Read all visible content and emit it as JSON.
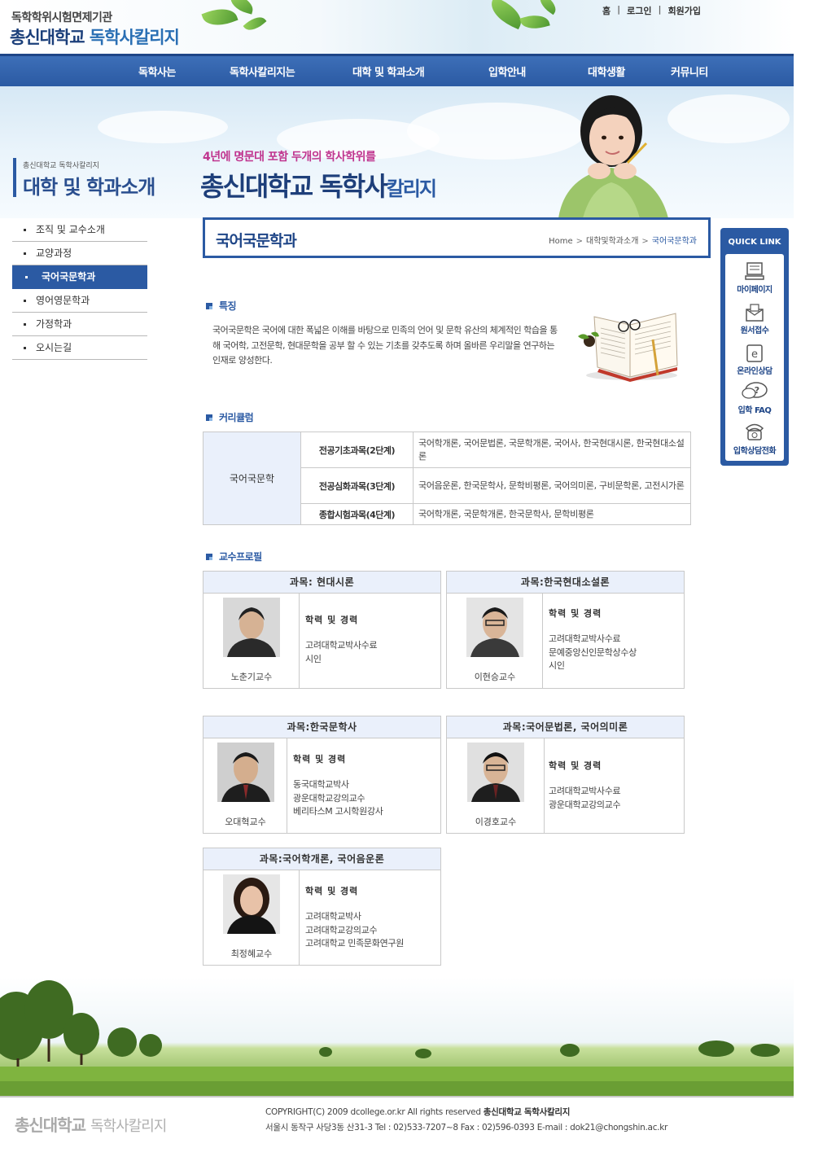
{
  "header": {
    "logo_sub": "독학학위시험면제기관",
    "logo_main_a": "총신대학교",
    "logo_main_b": "독학사칼리지",
    "top_links": [
      "홈",
      "로그인",
      "회원가입"
    ]
  },
  "gnb": [
    "독학사는",
    "독학사칼리지는",
    "대학 및 학과소개",
    "입학안내",
    "대학생활",
    "커뮤니티"
  ],
  "visual": {
    "section_sub": "총신대학교 독학사칼리지",
    "section_title": "대학 및 학과소개",
    "slogan_1": "4년에 명문대 포함 두개의 학사학위를",
    "slogan_2_a": "총신대학교 독학사",
    "slogan_2_b": "칼리지"
  },
  "lnb": [
    {
      "label": "조직 및 교수소개",
      "active": false
    },
    {
      "label": "교양과정",
      "active": false
    },
    {
      "label": "국어국문학과",
      "active": true
    },
    {
      "label": "영어영문학과",
      "active": false
    },
    {
      "label": "가정학과",
      "active": false
    },
    {
      "label": "오시는길",
      "active": false
    }
  ],
  "page": {
    "title": "국어국문학과",
    "breadcrumb": [
      "Home",
      "대학및학과소개",
      "국어국문학과"
    ]
  },
  "feature": {
    "heading": "특징",
    "text": "국어국문학은 국어에 대한 폭넓은 이해를 바탕으로 민족의 언어 및 문학 유산의 체계적인 학습을 통해 국어학, 고전문학, 현대문학을 공부 할 수 있는 기초를 갖추도록 하며 올바른 우리말을 연구하는 인재로 양성한다."
  },
  "curriculum": {
    "heading": "커리큘럼",
    "dept": "국어국문학",
    "rows": [
      {
        "stage": "전공기초과목(2단계)",
        "subjects": "국어학개론, 국어문법론, 국문학개론, 국어사, 한국현대시론, 한국현대소설론"
      },
      {
        "stage": "전공심화과목(3단계)",
        "subjects": "국어음운론, 한국문학사, 문학비평론, 국어의미론, 구비문학론, 고전시가론"
      },
      {
        "stage": "종합시험과목(4단계)",
        "subjects": "국어학개론, 국문학개론, 한국문학사, 문학비평론"
      }
    ]
  },
  "professors": {
    "heading": "교수프로필",
    "caption": "학력 및 경력",
    "items": [
      {
        "course": "과목: 현대시론",
        "name": "노춘기교수",
        "career": [
          "고려대학교박사수료",
          "시인"
        ]
      },
      {
        "course": "과목:한국현대소설론",
        "name": "이현승교수",
        "career": [
          "고려대학교박사수료",
          "문예중앙신인문학상수상",
          "시인"
        ]
      },
      {
        "course": "과목:한국문학사",
        "name": "오대혁교수",
        "career": [
          "동국대학교박사",
          "광운대학교강의교수",
          "베리타스M 고시학원강사"
        ]
      },
      {
        "course": "과목:국어문법론, 국어의미론",
        "name": "이경호교수",
        "career": [
          "고려대학교박사수료",
          "광운대학교강의교수"
        ]
      },
      {
        "course": "과목:국어학개론, 국어음운론",
        "name": "최정혜교수",
        "career": [
          "고려대학교박사",
          "고려대학교강의교수",
          "고려대학교 민족문화연구원"
        ]
      }
    ]
  },
  "quick": {
    "title": "QUICK LINK",
    "items": [
      {
        "label": "마이페이지",
        "icon": "mypage-icon"
      },
      {
        "label": "원서접수",
        "icon": "application-icon"
      },
      {
        "label": "온라인상담",
        "icon": "email-icon"
      },
      {
        "label": "입학 FAQ",
        "icon": "faq-icon"
      },
      {
        "label": "입학상담전화",
        "icon": "phone-icon"
      }
    ]
  },
  "footer": {
    "logo_a": "총신대학교",
    "logo_b": "독학사칼리지",
    "copyright_a": "COPYRIGHT(C) 2009 dcollege.or.kr   All rights reserved ",
    "copyright_b": "총신대학교 독학사칼리지",
    "address": "서울시 동작구 사당3동 산31-3  Tel : 02)533-7207~8   Fax : 02)596-0393  E-mail : dok21@chongshin.ac.kr"
  },
  "colors": {
    "brand": "#2b5aa3",
    "accent_pink": "#c0358f",
    "table_head": "#eaf0fb"
  }
}
